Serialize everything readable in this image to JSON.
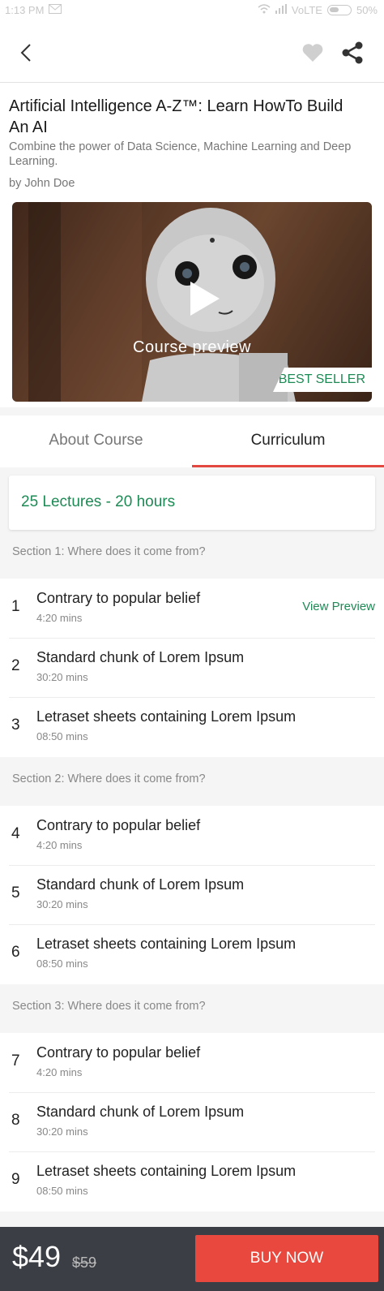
{
  "status_bar": {
    "time": "1:13 PM",
    "network": "VoLTE",
    "battery": "50%"
  },
  "course": {
    "title": "Artificial Intelligence A-Z™: Learn HowTo Build An AI",
    "subtitle": "Combine the power of Data Science, Machine Learning and Deep Learning.",
    "author": "by John Doe",
    "preview_caption": "Course preview",
    "badge": "BEST SELLER"
  },
  "tabs": [
    {
      "label": "About Course",
      "active": false
    },
    {
      "label": "Curriculum",
      "active": true
    }
  ],
  "summary": "25 Lectures - 20 hours",
  "sections": [
    {
      "title": "Section 1: Where does it come from?",
      "lectures": [
        {
          "num": "1",
          "name": "Contrary to popular belief",
          "duration": "4:20 mins",
          "action": "View Preview"
        },
        {
          "num": "2",
          "name": "Standard chunk of Lorem Ipsum",
          "duration": "30:20 mins"
        },
        {
          "num": "3",
          "name": "Letraset sheets containing Lorem Ipsum",
          "duration": "08:50 mins"
        }
      ]
    },
    {
      "title": "Section 2: Where does it come from?",
      "lectures": [
        {
          "num": "4",
          "name": "Contrary to popular belief",
          "duration": "4:20 mins"
        },
        {
          "num": "5",
          "name": "Standard chunk of Lorem Ipsum",
          "duration": "30:20 mins"
        },
        {
          "num": "6",
          "name": "Letraset sheets containing Lorem Ipsum",
          "duration": "08:50 mins"
        }
      ]
    },
    {
      "title": "Section 3: Where does it come from?",
      "lectures": [
        {
          "num": "7",
          "name": "Contrary to popular belief",
          "duration": "4:20 mins"
        },
        {
          "num": "8",
          "name": "Standard chunk of Lorem Ipsum",
          "duration": "30:20 mins"
        },
        {
          "num": "9",
          "name": "Letraset sheets containing Lorem Ipsum",
          "duration": "08:50 mins"
        }
      ]
    }
  ],
  "purchase": {
    "price": "$49",
    "old_price": "$59",
    "button": "BUY NOW"
  },
  "colors": {
    "accent": "#e8483d",
    "green": "#1e8a55",
    "bottom_bar": "#3b3e44"
  }
}
